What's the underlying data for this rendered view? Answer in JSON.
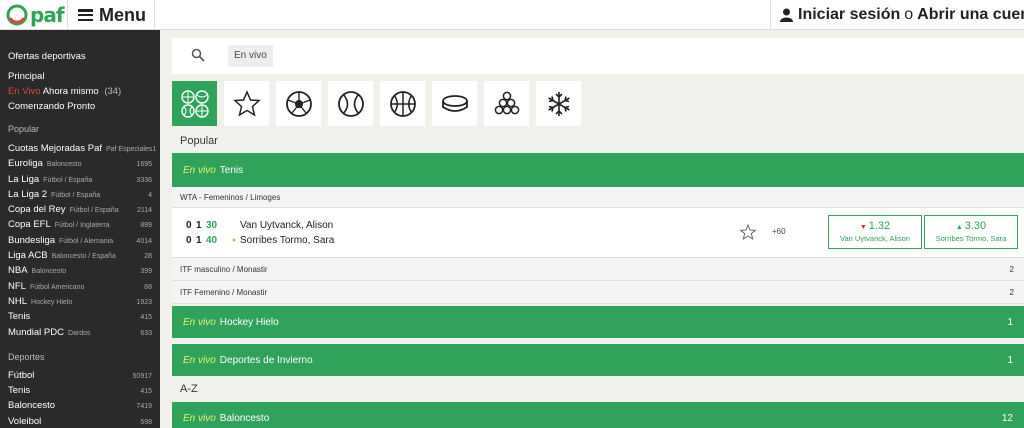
{
  "header": {
    "logo_text": "paf",
    "menu_label": "Menu",
    "login_label": "Iniciar sesión",
    "or_label": "o",
    "register_label": "Abrir una cuenta"
  },
  "sidebar": {
    "top_links": [
      {
        "label": "Ofertas deportivas"
      },
      {
        "label": "Principal"
      },
      {
        "red": "En Vivo",
        "label": "Ahora mismo",
        "count": "(34)"
      },
      {
        "label": "Comenzando Pronto"
      }
    ],
    "popular_title": "Popular",
    "popular": [
      {
        "name": "Cuotas Mejoradas Paf",
        "sub": "Paf Especiales",
        "count": "1"
      },
      {
        "name": "Euroliga",
        "sub": "Baloncesto",
        "count": "1695"
      },
      {
        "name": "La Liga",
        "sub": "Fútbol / España",
        "count": "3336"
      },
      {
        "name": "La Liga 2",
        "sub": "Fútbol / España",
        "count": "4"
      },
      {
        "name": "Copa del Rey",
        "sub": "Fútbol / España",
        "count": "2114"
      },
      {
        "name": "Copa EFL",
        "sub": "Fútbol / Inglaterra",
        "count": "889"
      },
      {
        "name": "Bundesliga",
        "sub": "Fútbol / Alemania",
        "count": "4014"
      },
      {
        "name": "Liga ACB",
        "sub": "Baloncesto / España",
        "count": "28"
      },
      {
        "name": "NBA",
        "sub": "Baloncesto",
        "count": "399"
      },
      {
        "name": "NFL",
        "sub": "Fútbol Americano",
        "count": "68"
      },
      {
        "name": "NHL",
        "sub": "Hockey Hielo",
        "count": "1923"
      },
      {
        "name": "Tenis",
        "sub": "",
        "count": "415"
      },
      {
        "name": "Mundial PDC",
        "sub": "Dardos",
        "count": "633"
      }
    ],
    "sports_title": "Deportes",
    "sports": [
      {
        "name": "Fútbol",
        "count": "50917"
      },
      {
        "name": "Tenis",
        "count": "415"
      },
      {
        "name": "Baloncesto",
        "count": "7419"
      },
      {
        "name": "Voleibol",
        "count": "598"
      }
    ]
  },
  "search": {
    "chip": "En vivo"
  },
  "sport_filters": [
    {
      "icon": "all-sports-icon",
      "active": true
    },
    {
      "icon": "favorites-star-icon",
      "active": false
    },
    {
      "icon": "football-icon",
      "active": false
    },
    {
      "icon": "tennis-icon",
      "active": false
    },
    {
      "icon": "basketball-icon",
      "active": false
    },
    {
      "icon": "ice-hockey-icon",
      "active": false
    },
    {
      "icon": "snooker-icon",
      "active": false
    },
    {
      "icon": "winter-sports-icon",
      "active": false
    }
  ],
  "main": {
    "popular_label": "Popular",
    "az_label": "A-Z",
    "live_prefix": "En vivo",
    "tennis_bar": "Tenis",
    "wta_row": "WTA - Femeninos / Limoges",
    "match": {
      "players": [
        {
          "sets": "0",
          "games": "1",
          "points": "30",
          "serving": false,
          "name": "Van Uytvanck, Alison"
        },
        {
          "sets": "0",
          "games": "1",
          "points": "40",
          "serving": true,
          "name": "Sorribes Tormo, Sara"
        }
      ],
      "more_markets": "+60",
      "odds": [
        {
          "value": "1.32",
          "trend": "down",
          "player": "Van Uytvanck, Alison"
        },
        {
          "value": "3.30",
          "trend": "up",
          "player": "Sorribes Tormo, Sara"
        }
      ]
    },
    "itf_rows": [
      {
        "label": "ITF masculino / Monastir",
        "count": "2"
      },
      {
        "label": "ITF Femenino / Monastir",
        "count": "2"
      }
    ],
    "hockey_bar": {
      "label": "Hockey Hielo",
      "count": "1"
    },
    "winter_bar": {
      "label": "Deportes de Invierno",
      "count": "1"
    },
    "basket_bar": {
      "label": "Baloncesto",
      "count": "12"
    }
  },
  "colors": {
    "brand_green": "#2fa35a",
    "live_yellow": "#e9f56a",
    "live_red": "#e2453c",
    "sidebar_bg": "#2a2a2a"
  }
}
